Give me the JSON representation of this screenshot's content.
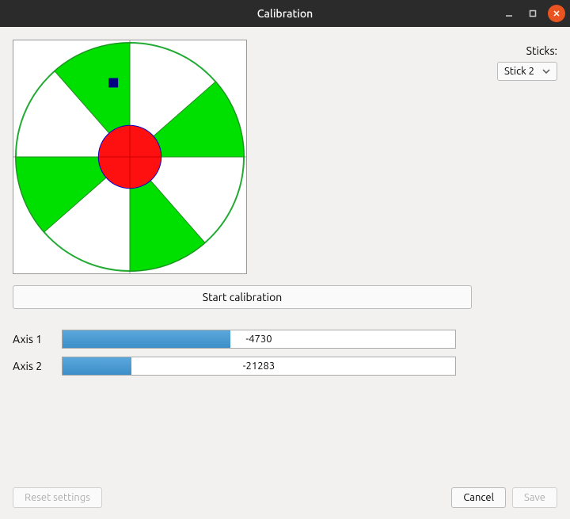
{
  "window": {
    "title": "Calibration"
  },
  "sticks": {
    "label": "Sticks:",
    "selected": "Stick 2"
  },
  "buttons": {
    "start_calibration": "Start calibration",
    "reset_settings": "Reset settings",
    "cancel": "Cancel",
    "save": "Save"
  },
  "axes": [
    {
      "label": "Axis 1",
      "value": -4730,
      "min": -32768,
      "max": 32767
    },
    {
      "label": "Axis 2",
      "value": -21283,
      "min": -32768,
      "max": 32767
    }
  ],
  "stick_indicator": {
    "x": -4730,
    "y": -21283,
    "range": 32768
  },
  "chart_data": {
    "type": "bar",
    "title": "",
    "xlabel": "",
    "ylabel": "",
    "categories": [
      "Axis 1",
      "Axis 2"
    ],
    "values": [
      -4730,
      -21283
    ],
    "ylim": [
      -32768,
      32767
    ]
  }
}
